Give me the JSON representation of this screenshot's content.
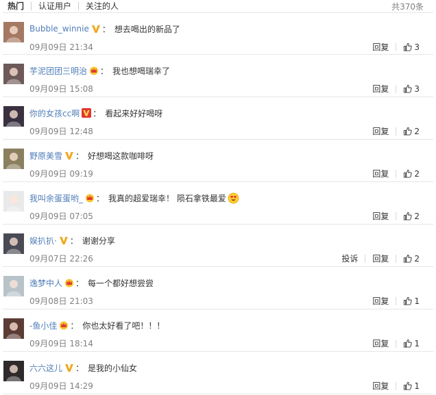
{
  "tabs": [
    {
      "label": "热门",
      "active": true
    },
    {
      "label": "认证用户",
      "active": false
    },
    {
      "label": "关注的人",
      "active": false
    }
  ],
  "total_label": "共370条",
  "actions": {
    "reply": "回复",
    "report": "投诉"
  },
  "colors": {
    "username": "#4f7db8",
    "muted": "#808080",
    "badge_gold": "#f0a91f",
    "badge_red": "#e2372e",
    "divider": "#e6e6e6"
  },
  "comments": [
    {
      "user": "Bubble_winnie",
      "badge": "v-gold",
      "colon": "：",
      "text": "想去喝出的新品了",
      "time": "09月09日 21:34",
      "likes": "3",
      "report": false,
      "avatar_color": "#a57864"
    },
    {
      "user": "芋泥团团三明治",
      "badge": "crown",
      "colon": "：",
      "text": "我也想喝瑞幸了",
      "time": "09月09日 15:08",
      "likes": "3",
      "report": false,
      "avatar_color": "#6d5a58"
    },
    {
      "user": "你的女孩cc啊",
      "badge": "v-red",
      "colon": "：",
      "text": "看起来好好喝呀",
      "time": "09月09日 12:48",
      "likes": "2",
      "report": false,
      "avatar_color": "#3a3140"
    },
    {
      "user": "野原美雪",
      "badge": "v-gold",
      "colon": "：",
      "text": "好想喝这款咖啡呀",
      "time": "09月09日 09:19",
      "likes": "2",
      "report": false,
      "avatar_color": "#8a7f5e"
    },
    {
      "user": "我叫余蛋蛋哟_",
      "badge": "crown",
      "colon": "：",
      "text": "我真的超爱瑞幸！ 陨石拿铁最爱",
      "time": "09月09日 07:05",
      "likes": "2",
      "report": false,
      "avatar_color": "#e9e9e9",
      "emoji": "heart-eyes-emoji"
    },
    {
      "user": "娱扒扒·",
      "badge": "v-gold",
      "colon": "：",
      "text": "谢谢分享",
      "time": "09月07日 22:26",
      "likes": "2",
      "report": true,
      "avatar_color": "#4a4a55"
    },
    {
      "user": "逸梦中人",
      "badge": "crown",
      "colon": "：",
      "text": "每一个都好想尝尝",
      "time": "09月08日 21:03",
      "likes": "1",
      "report": false,
      "avatar_color": "#b8c3c9"
    },
    {
      "user": "-鱼小佳",
      "badge": "crown",
      "colon": "：",
      "text": "你也太好看了吧！！！",
      "time": "09月09日 18:14",
      "likes": "1",
      "report": false,
      "avatar_color": "#5b3c34"
    },
    {
      "user": "六六这儿",
      "badge": "v-gold",
      "colon": "：",
      "text": "是我的小仙女",
      "time": "09月09日 14:29",
      "likes": "1",
      "report": false,
      "avatar_color": "#2e2a2c"
    }
  ]
}
